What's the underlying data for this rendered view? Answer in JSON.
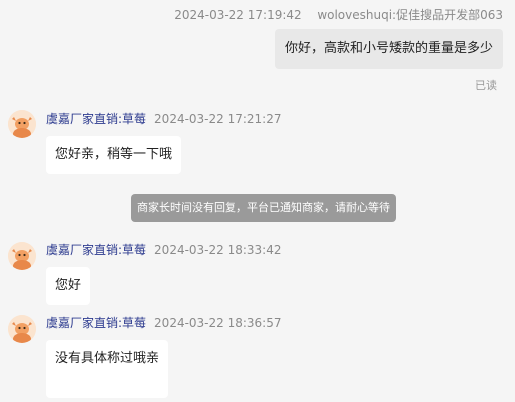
{
  "outgoing": {
    "timestamp": "2024-03-22 17:19:42",
    "sender": "woloveshuqi:促佳搜品开发部063",
    "text": "你好，高款和小号矮款的重量是多少",
    "status": "已读"
  },
  "incoming": [
    {
      "sender": "虞嘉厂家直销:草莓",
      "timestamp": "2024-03-22 17:21:27",
      "text": "您好亲，稍等一下哦"
    },
    {
      "sender": "虞嘉厂家直销:草莓",
      "timestamp": "2024-03-22 18:33:42",
      "text": "您好"
    },
    {
      "sender": "虞嘉厂家直销:草莓",
      "timestamp": "2024-03-22 18:36:57",
      "text": "没有具体称过哦亲"
    }
  ],
  "system_notice": "商家长时间没有回复，平台已通知商家，请耐心等待",
  "colors": {
    "background": "#f5f5f5",
    "outgoing_bubble": "#e8e8e8",
    "incoming_bubble": "#ffffff",
    "sender_name": "#2d3b8f",
    "notice_bg": "#9a9a9a"
  },
  "icons": {
    "avatar": "cartoon-bull-avatar-icon"
  }
}
